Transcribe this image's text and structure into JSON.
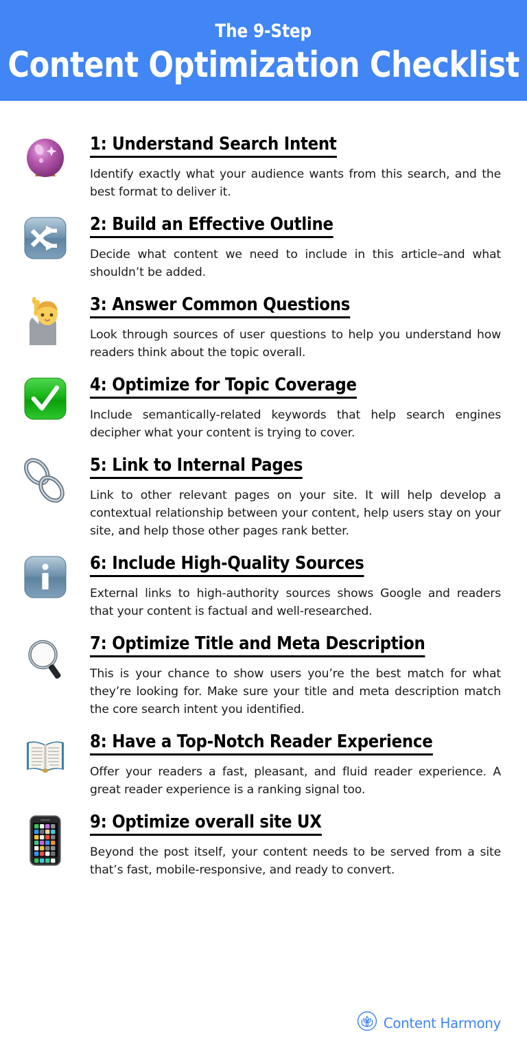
{
  "header": {
    "eyebrow": "The 9-Step",
    "title": "Content Optimization Checklist",
    "background_color": "#4285F4",
    "text_color": "#FFFFFF"
  },
  "steps": [
    {
      "icon": "crystal-ball-icon",
      "heading": "1: Understand Search Intent",
      "description": "Identify exactly what your audience wants from this search, and the best format to deliver it."
    },
    {
      "icon": "shuffle-arrows-icon",
      "heading": "2: Build an Effective Outline",
      "description": "Decide what content we need to include in this article–and what shouldn’t be added."
    },
    {
      "icon": "person-raising-hand-icon",
      "heading": "3: Answer Common Questions",
      "description": "Look through sources of user questions to help you understand how readers think about the topic overall."
    },
    {
      "icon": "green-check-mark-icon",
      "heading": "4: Optimize for Topic Coverage",
      "description": "Include semantically-related keywords that help search engines decipher what your content is trying to cover."
    },
    {
      "icon": "chain-link-icon",
      "heading": "5:  Link to Internal Pages",
      "description": "Link to other relevant pages on your site. It will help develop a contextual relationship between your content, help users stay on your site, and help those other pages rank better."
    },
    {
      "icon": "information-icon",
      "heading": "6: Include High-Quality Sources",
      "description": "External links to high-authority sources shows Google and readers that your content is factual and well-researched."
    },
    {
      "icon": "magnifying-glass-icon",
      "heading": "7: Optimize Title and Meta Description",
      "description": "This is your chance to show users you’re the best match for what they’re looking for. Make sure your title and meta description match the core search intent you identified."
    },
    {
      "icon": "open-book-icon",
      "heading": "8: Have a Top-Notch Reader Experience",
      "description": "Offer your readers a fast, pleasant, and fluid reader experience. A great reader experience is a ranking signal too."
    },
    {
      "icon": "mobile-phone-icon",
      "heading": "9: Optimize overall site UX",
      "description": "Beyond the post itself, your content needs to be served from a site that’s fast, mobile-responsive, and ready to convert."
    }
  ],
  "footer": {
    "logo_mark": "lotus-circle-logo-icon",
    "wordmark": "Content Harmony",
    "brand_color": "#4285F4"
  }
}
